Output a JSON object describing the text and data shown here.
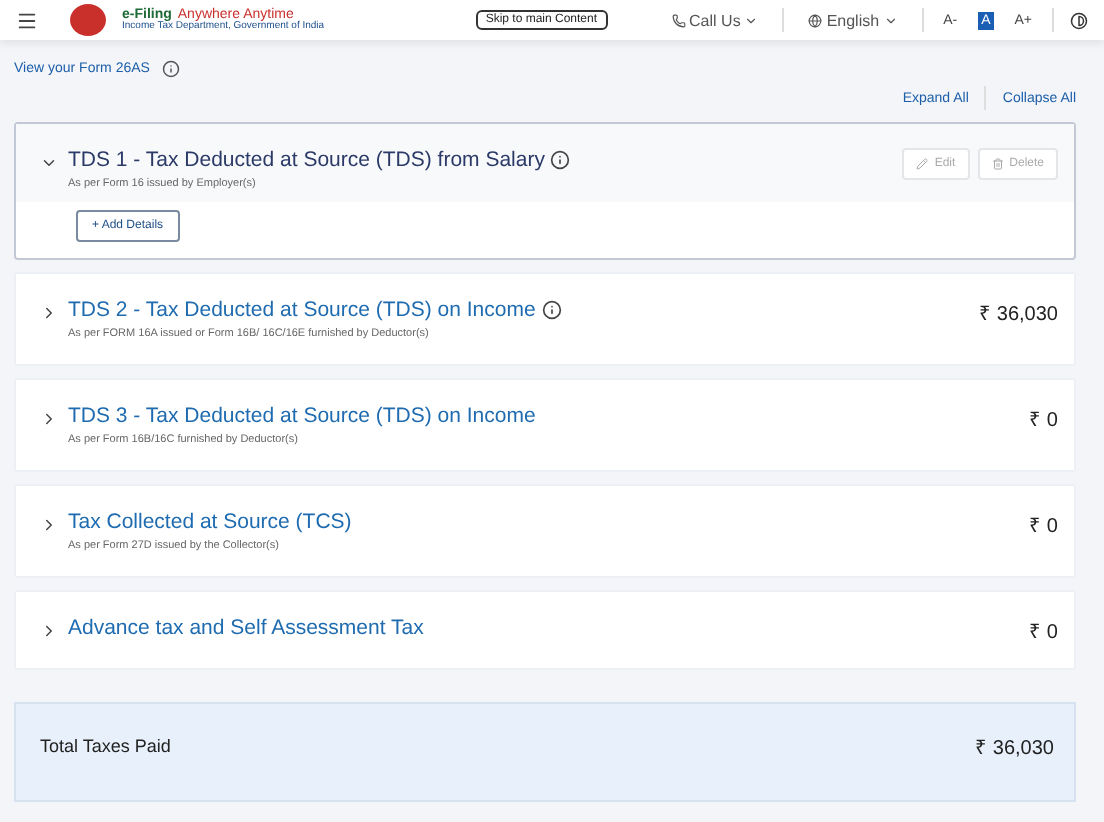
{
  "header": {
    "logo_title": "e-Filing",
    "logo_tagline": "Anywhere Anytime",
    "logo_subtitle": "Income Tax Department, Government of India",
    "skip_link": "Skip to main Content",
    "call_us": "Call Us",
    "language": "English",
    "font_buttons": [
      "A-",
      "A",
      "A+"
    ]
  },
  "form_link": "View your Form 26AS",
  "expand_all": "Expand All",
  "collapse_all": "Collapse All",
  "sections": [
    {
      "title": "TDS 1 - Tax Deducted at Source (TDS) from Salary",
      "subtitle": "As per Form 16 issued by Employer(s)",
      "expanded": true,
      "info": true,
      "actions": [
        "Edit",
        "Delete"
      ],
      "add_button": "+ Add Details"
    },
    {
      "title": "TDS 2 - Tax Deducted at Source (TDS) on Income",
      "subtitle": "As per FORM 16A issued or Form 16B/ 16C/16E furnished by Deductor(s)",
      "expanded": false,
      "info": true,
      "amount": "₹ 36,030"
    },
    {
      "title": "TDS 3 - Tax Deducted at Source (TDS) on Income",
      "subtitle": "As per Form 16B/16C furnished by Deductor(s)",
      "expanded": false,
      "info": false,
      "amount": "₹ 0"
    },
    {
      "title": "Tax Collected at Source (TCS)",
      "subtitle": "As per Form 27D issued by the Collector(s)",
      "expanded": false,
      "info": false,
      "amount": "₹ 0"
    },
    {
      "title": "Advance tax and Self Assessment Tax",
      "expanded": false,
      "info": false,
      "amount": "₹ 0"
    }
  ],
  "total": {
    "label": "Total Taxes Paid",
    "amount": "₹ 36,030"
  }
}
